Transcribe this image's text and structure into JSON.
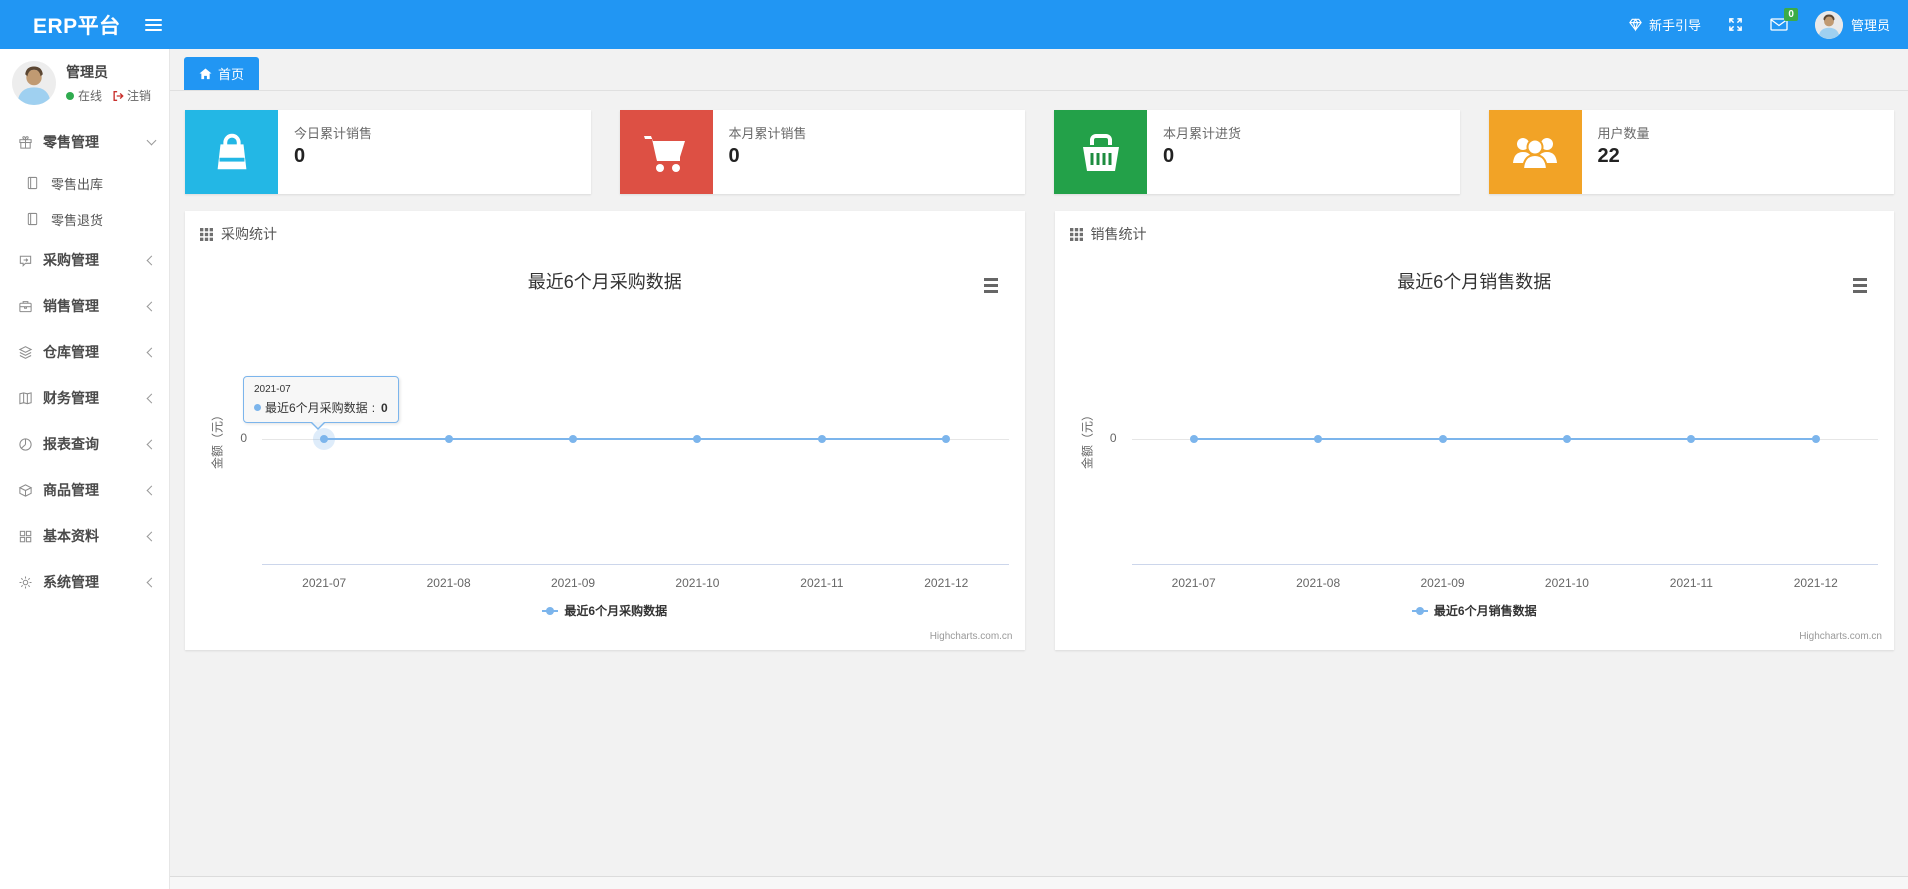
{
  "navbar": {
    "brand": "ERP平台",
    "guide_label": "新手引导",
    "mail_badge": "0",
    "user_name": "管理员",
    "bg_color": "#2196f3",
    "badge_color": "#3cab47"
  },
  "sidebar": {
    "user": {
      "name": "管理员",
      "status_label": "在线",
      "logout_label": "注销",
      "status_color": "#2fab4f"
    },
    "menu": [
      {
        "label": "零售管理",
        "icon": "gift-icon",
        "state": "expanded"
      },
      {
        "label": "零售出库",
        "icon": "file-icon",
        "child": true
      },
      {
        "label": "零售退货",
        "icon": "file-icon",
        "child": true
      },
      {
        "label": "采购管理",
        "icon": "repeat-icon",
        "state": "collapsed"
      },
      {
        "label": "销售管理",
        "icon": "briefcase-icon",
        "state": "collapsed"
      },
      {
        "label": "仓库管理",
        "icon": "layers-icon",
        "state": "collapsed"
      },
      {
        "label": "财务管理",
        "icon": "book-icon",
        "state": "collapsed"
      },
      {
        "label": "报表查询",
        "icon": "pie-chart-icon",
        "state": "collapsed"
      },
      {
        "label": "商品管理",
        "icon": "box-icon",
        "state": "collapsed"
      },
      {
        "label": "基本资料",
        "icon": "grid-icon",
        "state": "collapsed"
      },
      {
        "label": "系统管理",
        "icon": "gear-icon",
        "state": "collapsed"
      }
    ]
  },
  "breadcrumb": {
    "home_label": "首页"
  },
  "stat_cards": [
    {
      "label": "今日累计销售",
      "value": "0",
      "icon": "shopping-bag-icon",
      "color": "#23b7e5"
    },
    {
      "label": "本月累计销售",
      "value": "0",
      "icon": "shopping-cart-icon",
      "color": "#dd5044"
    },
    {
      "label": "本月累计进货",
      "value": "0",
      "icon": "shopping-basket-icon",
      "color": "#23a149"
    },
    {
      "label": "用户数量",
      "value": "22",
      "icon": "users-icon",
      "color": "#f2a326"
    }
  ],
  "panels": [
    {
      "title": "采购统计"
    },
    {
      "title": "销售统计"
    }
  ],
  "chart_data": [
    {
      "type": "line",
      "title": "最近6个月采购数据",
      "categories": [
        "2021-07",
        "2021-08",
        "2021-09",
        "2021-10",
        "2021-11",
        "2021-12"
      ],
      "series": [
        {
          "name": "最近6个月采购数据",
          "values": [
            0,
            0,
            0,
            0,
            0,
            0
          ],
          "color": "#7cb5ec"
        }
      ],
      "xlabel": "",
      "ylabel": "金额（元）",
      "yticks": [
        "0"
      ],
      "ylim": [
        0,
        0
      ],
      "grid": true,
      "legend_position": "bottom-center",
      "credit": "Highcharts.com.cn",
      "tooltip": {
        "visible": true,
        "header": "2021-07",
        "label": "最近6个月采购数据",
        "separator": ": ",
        "value": "0"
      }
    },
    {
      "type": "line",
      "title": "最近6个月销售数据",
      "categories": [
        "2021-07",
        "2021-08",
        "2021-09",
        "2021-10",
        "2021-11",
        "2021-12"
      ],
      "series": [
        {
          "name": "最近6个月销售数据",
          "values": [
            0,
            0,
            0,
            0,
            0,
            0
          ],
          "color": "#7cb5ec"
        }
      ],
      "xlabel": "",
      "ylabel": "金额（元）",
      "yticks": [
        "0"
      ],
      "ylim": [
        0,
        0
      ],
      "grid": true,
      "legend_position": "bottom-center",
      "credit": "Highcharts.com.cn",
      "tooltip": {
        "visible": false
      }
    }
  ]
}
